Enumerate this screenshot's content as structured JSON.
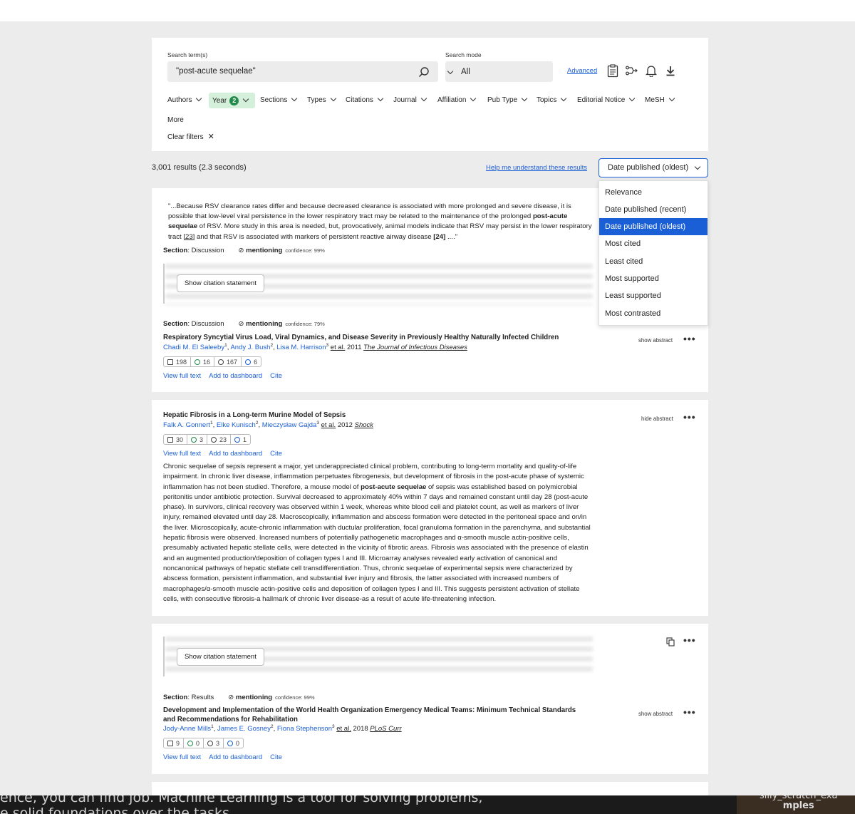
{
  "search": {
    "term_label": "Search term(s)",
    "term_value": "\"post-acute sequelae\"",
    "mode_label": "Search mode",
    "mode_value": "All",
    "advanced": "Advanced"
  },
  "filters": [
    "Authors",
    "Year",
    "Sections",
    "Types",
    "Citations",
    "Journal",
    "Affiliation",
    "Pub Type",
    "Topics",
    "Editorial Notice",
    "MeSH"
  ],
  "year_count": "2",
  "more": "More",
  "clear_filters": "Clear filters",
  "results": {
    "count_text": "3,001 results (2.3 seconds)",
    "help_link": "Help me understand these results",
    "sort_value": "Date published (oldest)",
    "sort_options": [
      "Relevance",
      "Date published (recent)",
      "Date published (oldest)",
      "Most cited",
      "Least cited",
      "Most supported",
      "Least supported",
      "Most contrasted"
    ]
  },
  "result1": {
    "snippet_pre": "\"...Because RSV clearance rates differ and because decreased clearance is associated with more prolonged and severe disease, it is possible that low-level viral persistence in the lower respiratory tract may be related to the maintenance of the prolonged ",
    "snippet_bold": "post-acute sequelae",
    "snippet_mid": " of RSV. More study in this area is needed, but, provocatively, animal models indicate that RSV may persist in the lower respiratory tract ",
    "snippet_ref1": "[23]",
    "snippet_mid2": " and that RSV is associated with markers of persistent reactive airway disease ",
    "snippet_ref2": "[24]",
    "snippet_end": " ....\"",
    "section1_label": "Section",
    "section1_value": ": Discussion",
    "mention1": "mentioning",
    "conf1": "confidence: 99%",
    "show_citation": "Show citation statement",
    "section2_label": "Section",
    "section2_value": ": Discussion",
    "mention2": "mentioning",
    "conf2": "confidence: 79%",
    "title": "Respiratory Syncytial Virus Load, Viral Dynamics, and Disease Severity in Previously Healthy Naturally Infected Children",
    "author1": "Chadi M. El Saleeby",
    "sup1": "1",
    "author2": "Andy J. Bush",
    "sup2": "2",
    "author3": "Lisa M. Harrison",
    "sup3": "3",
    "etal": "et al.",
    "year": "2011",
    "journal": "The Journal of Infectious Diseases",
    "stats": [
      "198",
      "16",
      "167",
      "6"
    ],
    "show_abstract": "show abstract",
    "view_full": "View full text",
    "add_dash": "Add to dashboard",
    "cite": "Cite"
  },
  "result2": {
    "title": "Hepatic Fibrosis in a Long-term Murine Model of Sepsis",
    "author1": "Falk A. Gonnert",
    "sup1": "1",
    "author2": "Elke Kunisch",
    "sup2": "2",
    "author3": "Mieczysław Gajda",
    "sup3": "3",
    "etal": "et al.",
    "year": "2012",
    "journal": "Shock",
    "stats": [
      "30",
      "3",
      "23",
      "1"
    ],
    "hide_abstract": "hide abstract",
    "view_full": "View full text",
    "add_dash": "Add to dashboard",
    "cite": "Cite",
    "abstract_pre": "Chronic sequelae of sepsis represent a major, yet underappreciated clinical problem, contributing to long-term mortality and quality-of-life impairment. In chronic liver disease, inflammation perpetuates fibrogenesis, but development of fibrosis in the post-acute phase of systemic inflammation has not been studied. Therefore, a mouse model of ",
    "abstract_bold": "post-acute sequelae",
    "abstract_post": " of sepsis was established based on polymicrobial peritonitis under antibiotic protection. Survival decreased to approximately 40% within 7 days and remained constant until day 28 (post-acute phase). In survivors, clinical recovery was observed within 1 week, whereas white blood cell and platelet count, as well as markers of liver injury, remained elevated until day 28. Macroscopically, inflammation and abscess formation were detected in the peritoneal space and on/in the liver. Microscopically, acute-chronic inflammation with ductular proliferation, focal granuloma formation in the parenchyma, and substantial hepatic fibrosis were observed. Increased numbers of potentially pathogenetic macrophages and α-smooth muscle actin-positive cells, presumably activated hepatic stellate cells, were detected in the vicinity of fibrotic areas. Fibrosis was associated with the presence of elastin and an augmented production/deposition of collagen types I and III. Microarray analyses revealed early activation of canonical and noncanonical pathways of hepatic stellate cell transdifferentiation. Thus, chronic sequelae of experimental sepsis were characterized by abscess formation, persistent inflammation, and substantial liver injury and fibrosis, the latter associated with increased numbers of macrophages/α-smooth muscle actin-positive cells and deposition of collagen types I and III. This suggests persistent activation of stellate cells, with consecutive fibrosis-a hallmark of chronic liver disease-as a result of acute life-threatening infection."
  },
  "result3": {
    "show_citation": "Show citation statement",
    "section_label": "Section",
    "section_value": ": Results",
    "mention": "mentioning",
    "conf": "confidence: 99%",
    "title": "Development and Implementation of the World Health Organization Emergency Medical Teams: Minimum Technical Standards and Recommendations for Rehabilitation",
    "author1": "Jody-Anne Mills",
    "sup1": "1",
    "author2": "James E. Gosney",
    "sup2": "2",
    "author3": "Fiona Stephenson",
    "sup3": "3",
    "etal": "et al.",
    "year": "2018",
    "journal": "PLoS Curr",
    "stats": [
      "9",
      "0",
      "3",
      "0"
    ],
    "show_abstract": "show abstract",
    "view_full": "View full text",
    "add_dash": "Add to dashboard",
    "cite": "Cite"
  },
  "overlay": {
    "line1": "ence, you can find job. Machine Learning is a tool for solving problems,",
    "line2": "e solid foundations over the tasks",
    "thumb1": "silly_scratch_exa",
    "thumb2": "mples"
  }
}
